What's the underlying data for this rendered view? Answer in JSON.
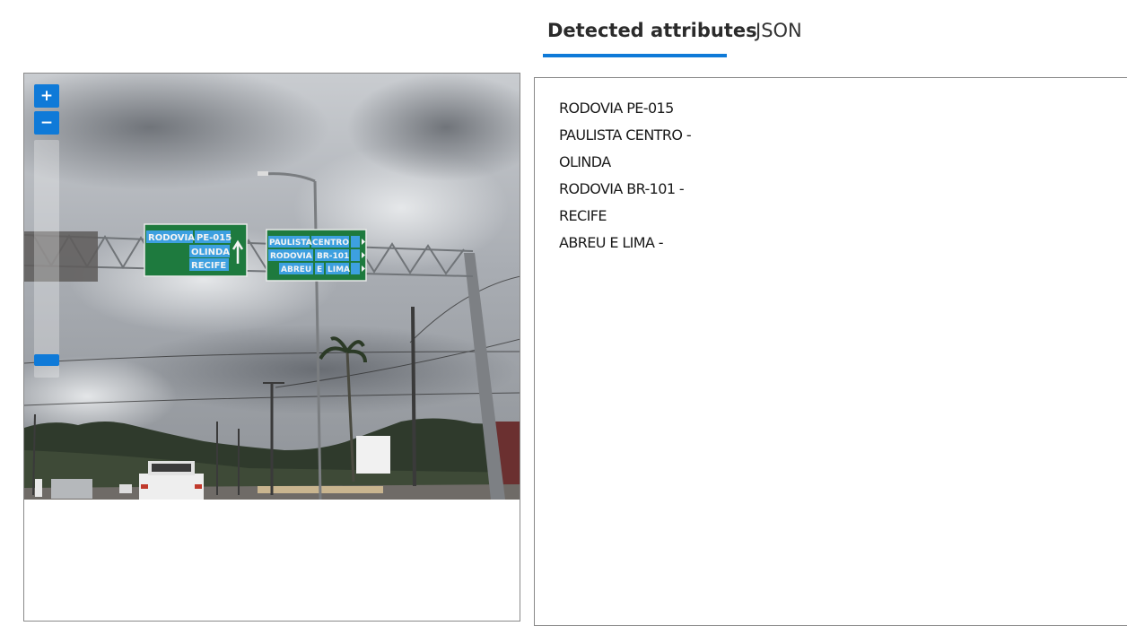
{
  "tabs": {
    "detected_label": "Detected attributes",
    "json_label": "JSON",
    "active": "detected"
  },
  "zoom": {
    "in_label": "+",
    "out_label": "−",
    "level_fraction": 0.05
  },
  "sign_left": {
    "lines": [
      "RODOVIA",
      "PE-015",
      "OLINDA",
      "RECIFE"
    ]
  },
  "sign_right": {
    "lines": [
      "PAULISTA",
      "CENTRO",
      "RODOVIA",
      "BR-101",
      "ABREU",
      "E",
      "LIMA"
    ]
  },
  "attributes": [
    "RODOVIA PE-015",
    "PAULISTA CENTRO -",
    "OLINDA",
    "RODOVIA BR-101 -",
    "RECIFE",
    "ABREU E LIMA -"
  ],
  "colors": {
    "accent": "#0f7ad8",
    "sign_green": "#1e7a3e",
    "highlight": "#3da0e0"
  }
}
